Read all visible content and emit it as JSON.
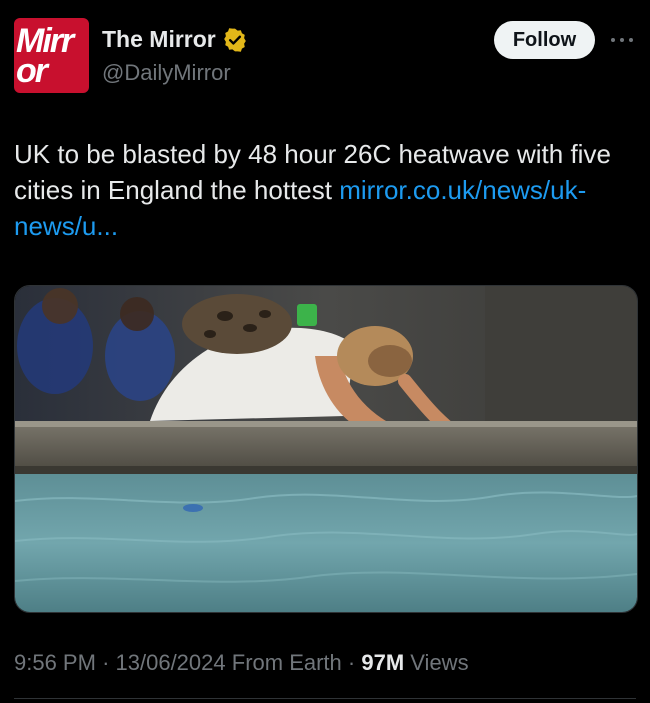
{
  "account": {
    "avatar_text": "Mirr\nor",
    "display_name": "The Mirror",
    "handle": "@DailyMirror",
    "verified_badge_color": "#e2b719"
  },
  "actions": {
    "follow_label": "Follow",
    "more_icon": "more-horizontal-icon"
  },
  "tweet": {
    "text": "UK to be blasted by 48 hour 26C heatwave with five cities in England the hottest ",
    "link_text": "mirror.co.uk/news/uk-news/u...",
    "link_color": "#1d9bf0"
  },
  "media": {
    "description": "photo"
  },
  "meta": {
    "time": "9:56 PM",
    "separator": "·",
    "date": "13/06/2024",
    "source": "From Earth",
    "views_count": "97M",
    "views_label": "Views"
  },
  "colors": {
    "background": "#000000",
    "text_primary": "#e7e9ea",
    "text_secondary": "#71767b",
    "brand_red": "#c8102e"
  }
}
